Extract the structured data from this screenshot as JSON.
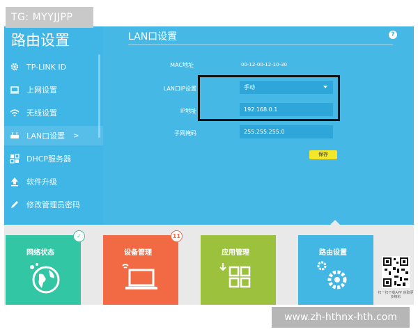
{
  "watermarks": {
    "top": "TG: MYYJJPP",
    "bottom": "www.zh-hthnx-hth.com"
  },
  "sidebar": {
    "title": "路由设置",
    "items": [
      {
        "label": "TP-LINK ID",
        "icon": "gear-icon"
      },
      {
        "label": "上网设置",
        "icon": "monitor-icon"
      },
      {
        "label": "无线设置",
        "icon": "wifi-icon"
      },
      {
        "label": "LAN口设置",
        "icon": "router-icon",
        "active": true,
        "chevron": ">"
      },
      {
        "label": "DHCP服务器",
        "icon": "dhcp-icon"
      },
      {
        "label": "软件升级",
        "icon": "upgrade-icon"
      },
      {
        "label": "修改管理员密码",
        "icon": "pencil-icon"
      }
    ]
  },
  "content": {
    "title": "LAN口设置",
    "help": "?",
    "fields": {
      "mac_label": "MAC地址",
      "mac_value": "00-12-00-12-10-30",
      "lan_ip_setting_label": "LAN口IP设置",
      "lan_ip_setting_value": "手动",
      "ip_label": "IP地址",
      "ip_value": "192.168.0.1",
      "mask_label": "子网掩码",
      "mask_value": "255.255.255.0"
    },
    "save_label": "保存"
  },
  "tiles": [
    {
      "label": "网络状态",
      "color": "#33c6a4",
      "badge": "✓"
    },
    {
      "label": "设备管理",
      "color": "#f26a43",
      "badge": "11"
    },
    {
      "label": "应用管理",
      "color": "#9cc23d"
    },
    {
      "label": "路由设置",
      "color": "#42b7e4"
    }
  ],
  "qr_caption": "扫一扫下载APP 获取更多精彩",
  "colors": {
    "sidebar": "#3fb6e5",
    "content": "#45b8e6",
    "field": "#2ea6da",
    "save": "#f4e629",
    "highlight": "#111111"
  }
}
